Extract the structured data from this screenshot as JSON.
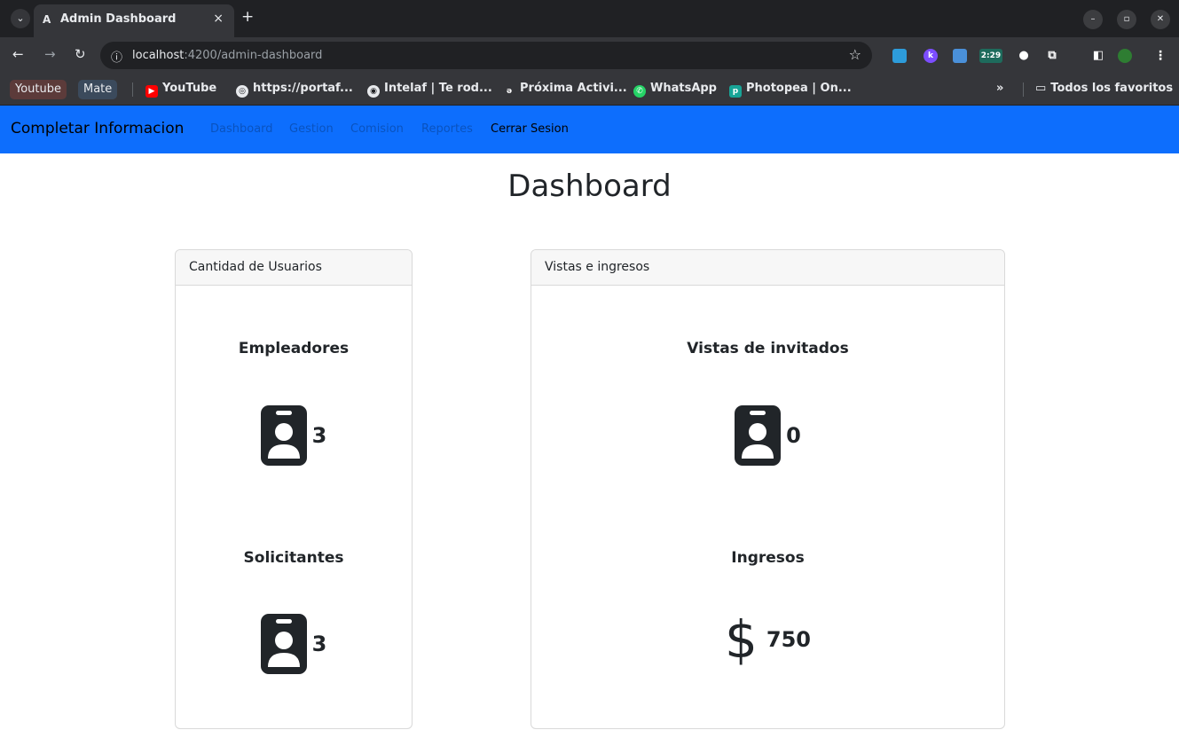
{
  "browser": {
    "tab_title": "Admin Dashboard",
    "tab_favicon": "A",
    "tab_close": "×",
    "new_tab": "+",
    "tab_menu": "⌄",
    "url_host": "localhost",
    "url_path": ":4200/admin-dashboard",
    "ext_badge": "2:29",
    "bookmarks": {
      "chip1": "Youtube",
      "chip2": "Mate",
      "items": [
        "YouTube",
        "https://portaf...",
        "Intelaf | Te rod...",
        "Próxima Activi...",
        "WhatsApp",
        "Photopea | On..."
      ],
      "overflow": "»",
      "all": "Todos los favoritos"
    }
  },
  "navbar": {
    "brand": "Completar Informacion",
    "links": [
      "Dashboard",
      "Gestion",
      "Comision",
      "Reportes",
      "Cerrar Sesion"
    ]
  },
  "page": {
    "title": "Dashboard"
  },
  "cards": {
    "users": {
      "header": "Cantidad de Usuarios",
      "employers_title": "Empleadores",
      "employers_value": "3",
      "applicants_title": "Solicitantes",
      "applicants_value": "3"
    },
    "views": {
      "header": "Vistas e ingresos",
      "guest_views_title": "Vistas de invitados",
      "guest_views_value": "0",
      "income_title": "Ingresos",
      "income_symbol": "$",
      "income_value": "750"
    }
  },
  "colors": {
    "navbar": "#0d6efd",
    "chrome_dark": "#202124",
    "chrome_mid": "#35363a"
  }
}
